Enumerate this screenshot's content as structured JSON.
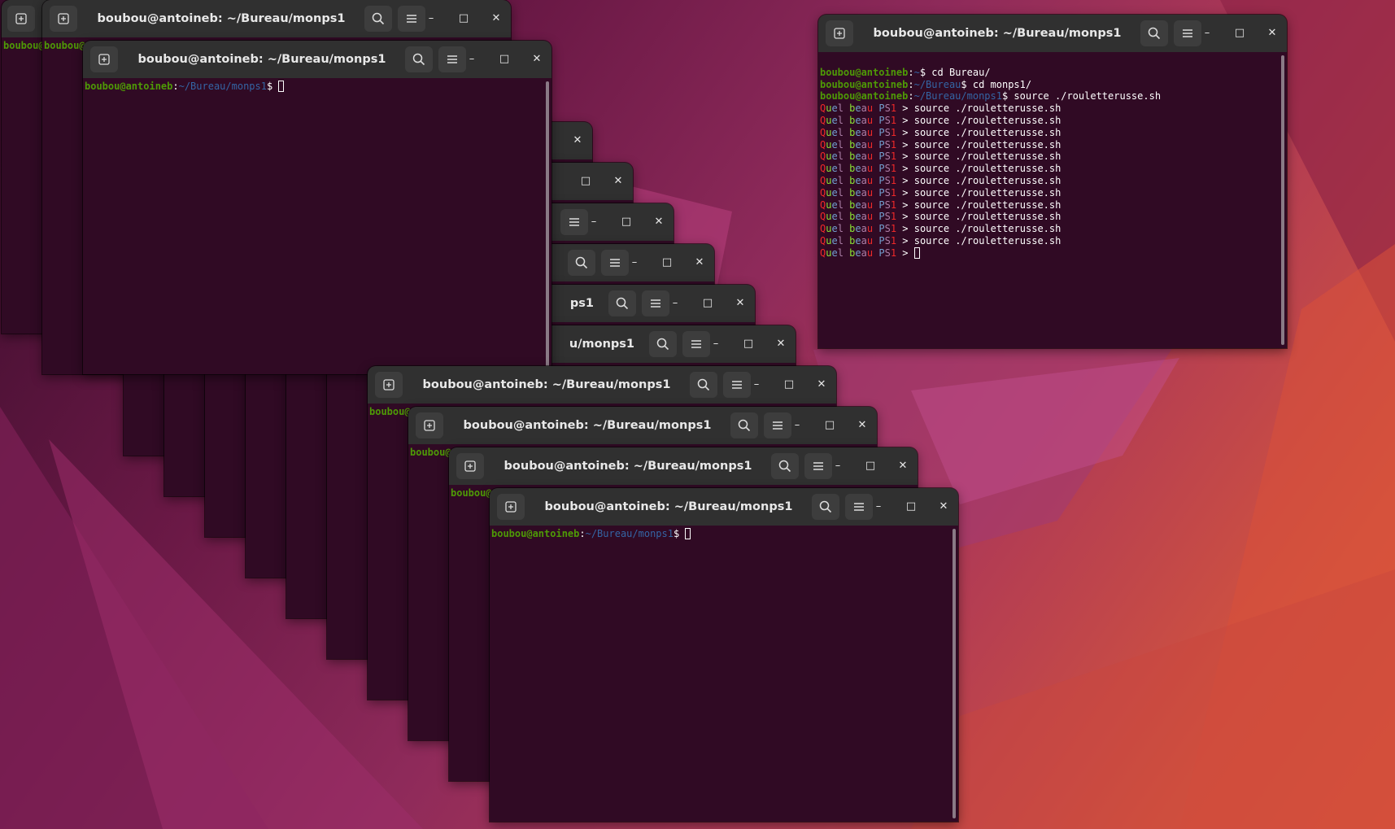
{
  "desktop": {
    "wallpaper_colors": [
      "#3a0d2c",
      "#8e2a5a",
      "#d2543e"
    ]
  },
  "window_title": "boubou@antoineb: ~/Bureau/monps1",
  "partial_titles": {
    "t5": "ps1",
    "t6": "u/monps1"
  },
  "prompt": {
    "user_host": "boubou@antoineb",
    "colon": ":",
    "path": "~/Bureau/monps1",
    "dollar": "$ ",
    "truncated_user": "boubou@"
  },
  "right_terminal": {
    "title": "boubou@antoineb: ~/Bureau/monps1",
    "lines": [
      {
        "user": "boubou@antoineb",
        "path": "~",
        "cmd": "$ cd Bureau/"
      },
      {
        "user": "boubou@antoineb",
        "path": "~/Bureau",
        "cmd": "$ cd monps1/"
      },
      {
        "user": "boubou@antoineb",
        "path": "~/Bureau/monps1",
        "cmd": "$ source ./rouletterusse.sh"
      }
    ],
    "ps1_words": {
      "w1": "Quel",
      "w2": "beau",
      "w3": "PS1",
      "arrow": " > "
    },
    "ps1_command": "source ./rouletterusse.sh",
    "repeat_count_lines": 12
  },
  "icons": {
    "new_tab": "new-tab-icon",
    "search": "search-icon",
    "menu": "hamburger-menu-icon",
    "minimize": "minimize-icon",
    "maximize": "maximize-icon",
    "close": "close-icon"
  }
}
